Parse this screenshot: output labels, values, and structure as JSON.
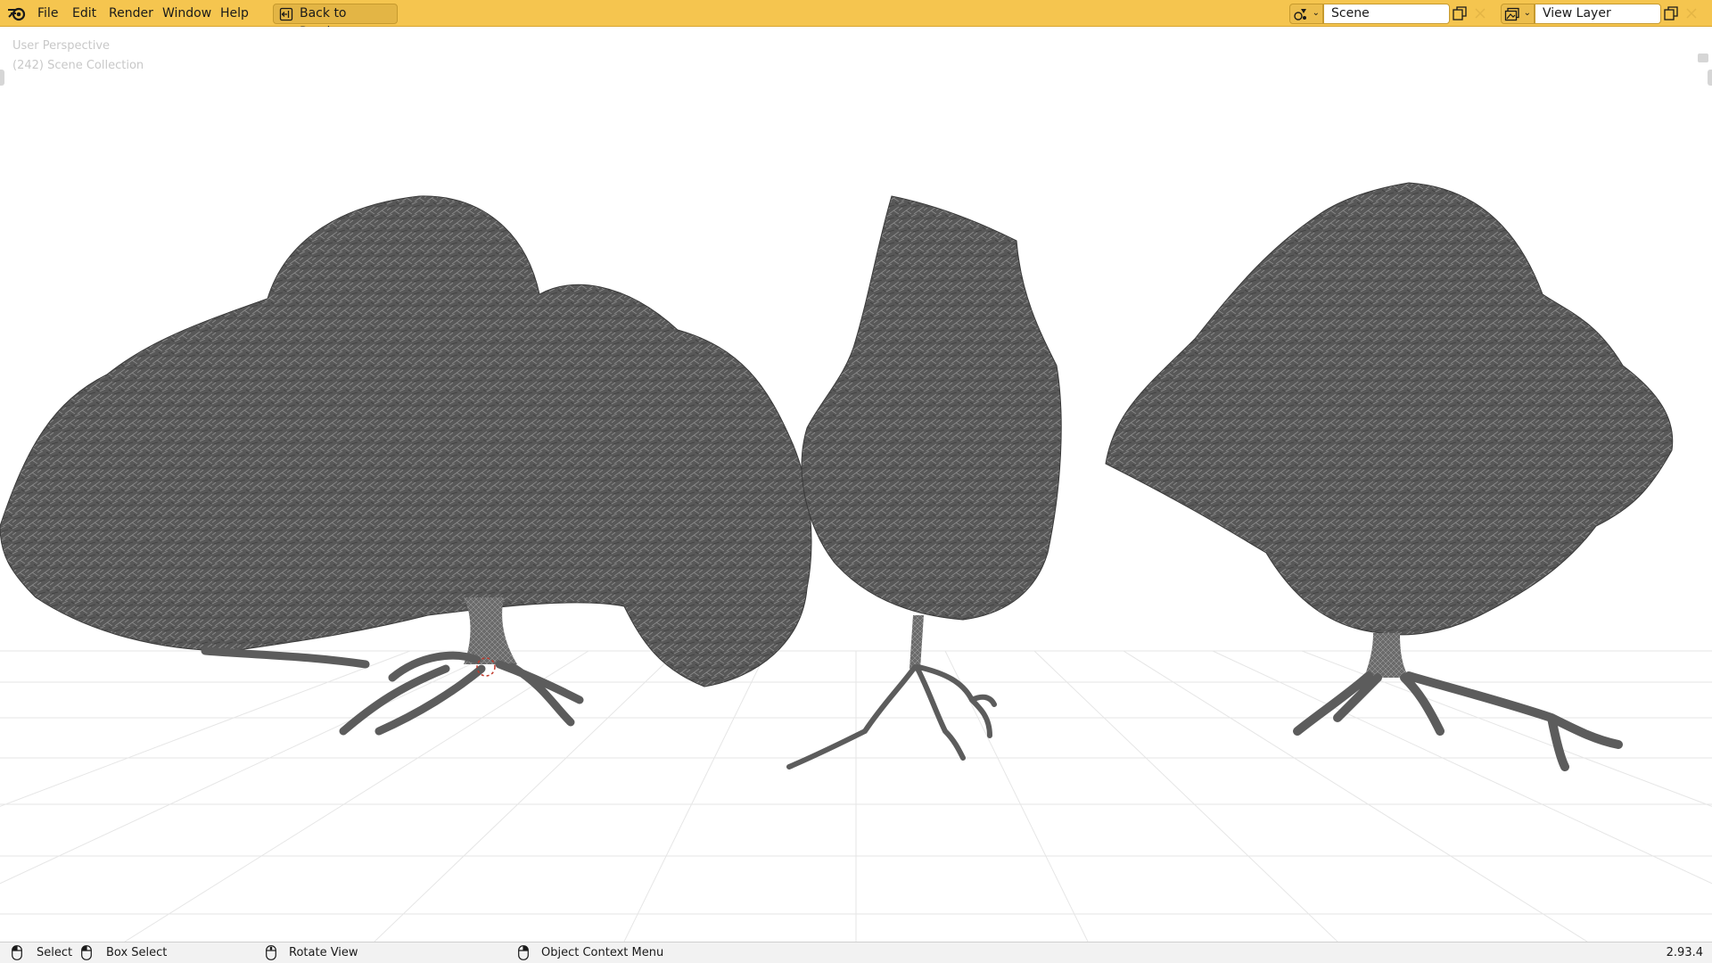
{
  "menu": {
    "items": [
      "File",
      "Edit",
      "Render",
      "Window",
      "Help"
    ],
    "back_label": "Back to Previous"
  },
  "workspace": {
    "scene_name": "Scene",
    "view_layer_name": "View Layer"
  },
  "viewport": {
    "perspective_label": "User Perspective",
    "collection_label": "(242) Scene Collection"
  },
  "status": {
    "select": "Select",
    "box_select": "Box Select",
    "rotate_view": "Rotate View",
    "context_menu": "Object Context Menu",
    "version": "2.93.4"
  },
  "colors": {
    "header": "#f5c54f",
    "foliage": "#555555",
    "grid": "#e8e8e8"
  },
  "icons": {
    "logo": "blender-logo-icon",
    "back": "back-to-previous-icon",
    "scene_type": "scene-icon",
    "layer_type": "view-layer-icon",
    "copy": "duplicate-icon",
    "close": "close-icon",
    "mouse": "mouse-icon"
  }
}
